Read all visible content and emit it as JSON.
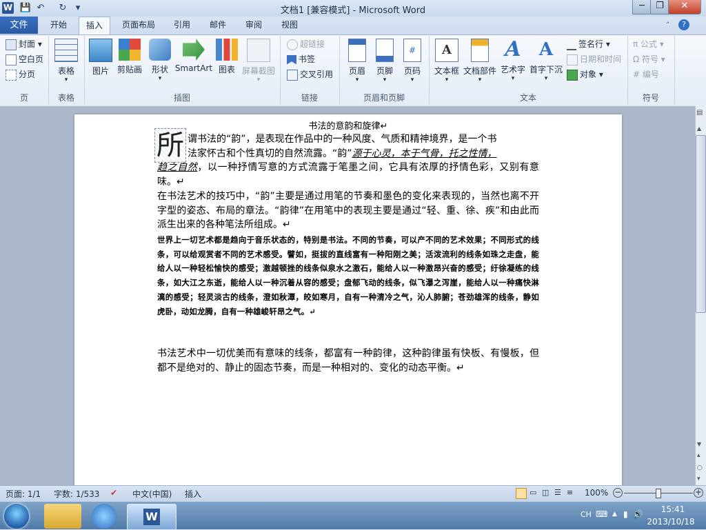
{
  "window": {
    "title": "文档1 [兼容模式] - Microsoft Word",
    "app_icon_letter": "W",
    "min": "─",
    "max": "❐",
    "close": "✕"
  },
  "quick_access": [
    "💾",
    "↶",
    "↻",
    "▾"
  ],
  "tabs": [
    {
      "label": "文件"
    },
    {
      "label": "开始"
    },
    {
      "label": "插入"
    },
    {
      "label": "页面布局"
    },
    {
      "label": "引用"
    },
    {
      "label": "邮件"
    },
    {
      "label": "审阅"
    },
    {
      "label": "视图"
    }
  ],
  "ribbon": {
    "pages": {
      "label": "页",
      "items": [
        "封面 ▾",
        "空白页",
        "分页"
      ]
    },
    "tables": {
      "label": "表格",
      "items": [
        "表格"
      ]
    },
    "illustrations": {
      "label": "插图",
      "items": [
        "图片",
        "剪贴画",
        "形状",
        "SmartArt",
        "图表",
        "屏幕截图"
      ]
    },
    "links": {
      "label": "链接",
      "items": [
        "超链接",
        "书签",
        "交叉引用"
      ]
    },
    "header_footer": {
      "label": "页眉和页脚",
      "items": [
        "页眉",
        "页脚",
        "页码"
      ]
    },
    "text": {
      "label": "文本",
      "items": [
        "文本框",
        "文档部件",
        "艺术字",
        "首字下沉"
      ],
      "small": [
        "签名行 ▾",
        "日期和时间",
        "对象 ▾"
      ]
    },
    "symbols": {
      "label": "符号",
      "items": [
        "公式 ▾",
        "符号 ▾",
        "编号"
      ]
    }
  },
  "document": {
    "title": "书法的意韵和旋律↵",
    "dropcap": "所",
    "p1_a": "谓书法的“韵”，是表现在作品中的一种风度、气质和精神境界，是一个书",
    "p1_b": "法家怀古和个性真切的自然流露。“韵”",
    "p1_c": "源于心灵，本于气骨，托之性情，",
    "p1_d": "趋之自然",
    "p1_e": "，以一种抒情写意的方式流露于笔墨之间，它具有浓厚的抒情色彩，又别有意味。↵",
    "p2": "在书法艺术的技巧中，“韵”主要是通过用笔的节奏和墨色的变化来表现的，当然也离不开字型的姿态、布局的章法。“韵律”在用笔中的表现主要是通过“轻、重、徐、疾”和由此而派生出来的各种笔法所组成。↵",
    "p3": "世界上一切艺术都是趋向于音乐状态的，特别是书法。不同的节奏，可以产不同的艺术效果；不同形式的线条，可以给观赏者不同的艺术感受。譬如，挺拔的直线富有一种阳刚之美；活泼流利的线条如珠之走盘，能给人以一种轻松愉快的感受；激越顿挫的线条似泉水之激石，能给人以一种激昂兴奋的感受；纡徐凝练的线条，如大江之东逝，能给人以一种沉着从容的感受；盘郁飞动的线条，似飞瀑之泻崖，能给人以一种痛快淋漓的感受；轻灵淡古的线条，澄如秋潭，皎如寒月，自有一种清冷之气，沁人肺腑；苍劲雄浑的线条，静如虎卧，动如龙腾，自有一种雄峻轩昂之气。↵",
    "p4": "书法艺术中一切优美而有意味的线条，都富有一种韵律，这种韵律虽有快板、有慢板，但都不是绝对的、静止的固态节奏，而是一种相对的、变化的动态平衡。↵"
  },
  "status": {
    "page": "页面: 1/1",
    "words": "字数: 1/533",
    "lang": "中文(中国)",
    "mode": "插入",
    "zoom": "100%"
  },
  "taskbar": {
    "ime": "CH",
    "time": "15:41",
    "date": "2013/10/18"
  }
}
